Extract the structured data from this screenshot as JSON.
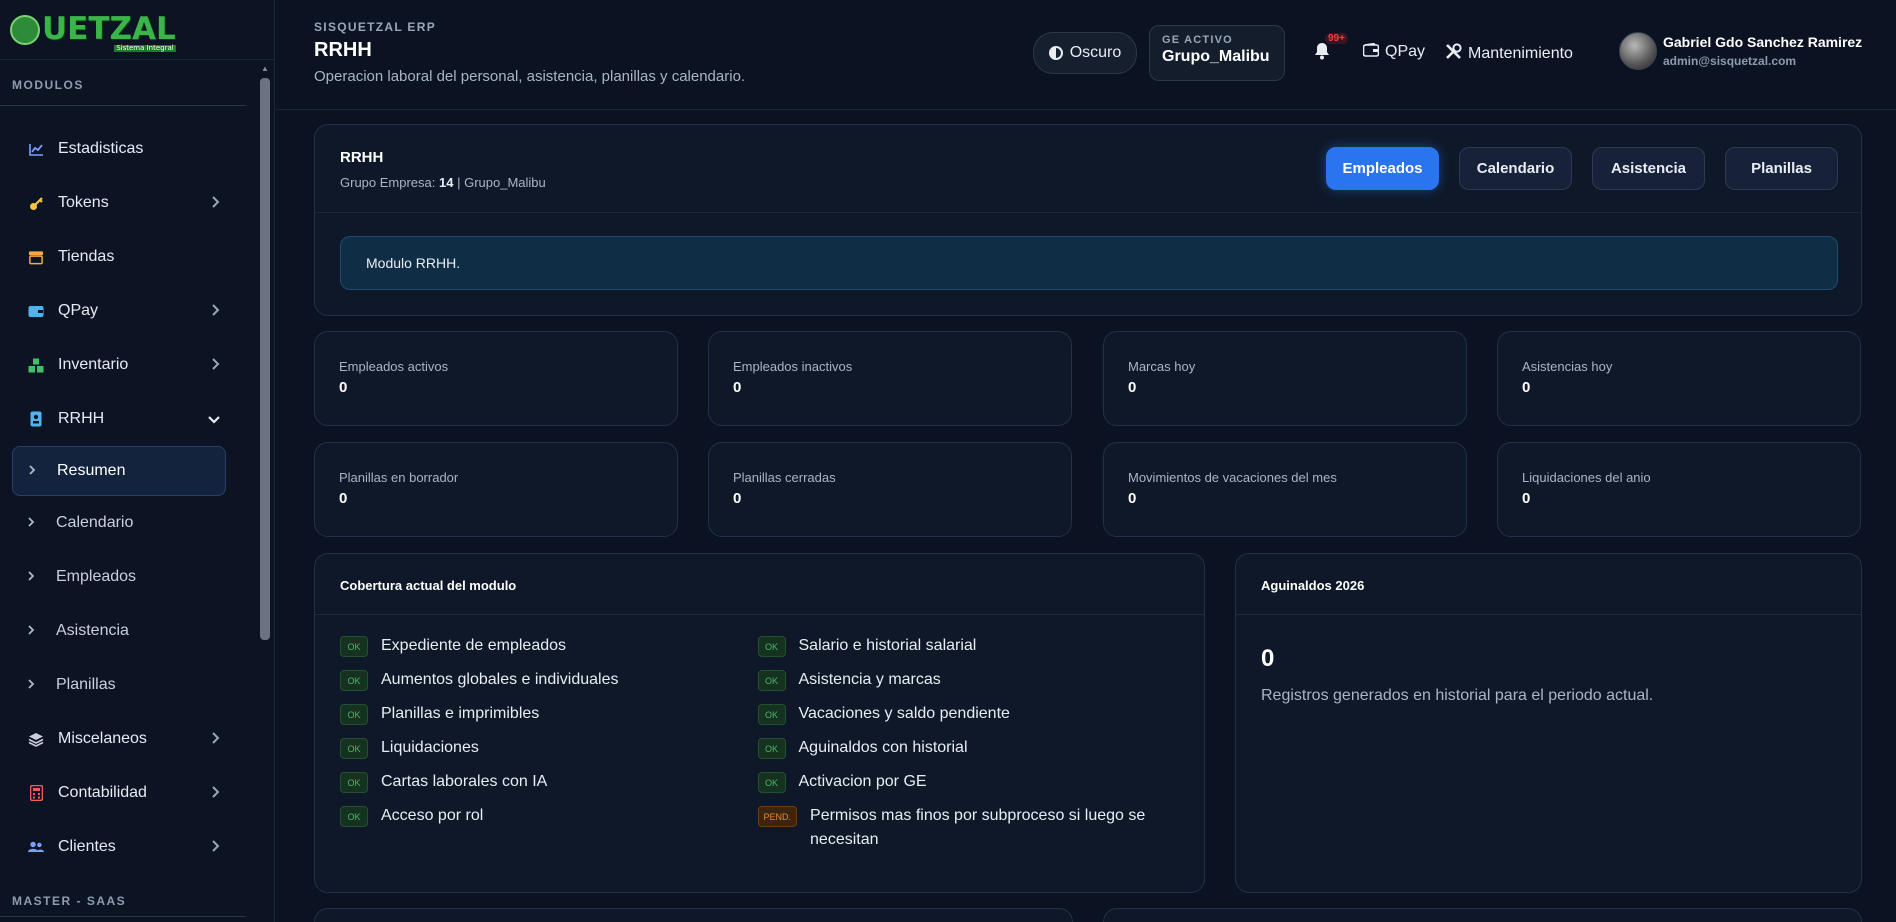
{
  "logo": {
    "text": "UETZAL",
    "sub": "Sistema Integral"
  },
  "sidebar": {
    "section_modules": "MODULOS",
    "section_master": "MASTER - SAAS",
    "items": [
      {
        "label": "Estadisticas",
        "icon": "chart-line-icon",
        "color": "#7aa2ff",
        "chevron": false
      },
      {
        "label": "Tokens",
        "icon": "key-icon",
        "color": "#f5c542",
        "chevron": true
      },
      {
        "label": "Tiendas",
        "icon": "store-icon",
        "color": "#f5a742",
        "chevron": false
      },
      {
        "label": "QPay",
        "icon": "wallet-icon",
        "color": "#4fb3f0",
        "chevron": true
      },
      {
        "label": "Inventario",
        "icon": "boxes-icon",
        "color": "#3fbf6a",
        "chevron": true
      },
      {
        "label": "RRHH",
        "icon": "id-badge-icon",
        "color": "#4fb3f0",
        "chevron": true,
        "expanded": true
      }
    ],
    "subitems": [
      {
        "label": "Resumen",
        "active": true
      },
      {
        "label": "Calendario"
      },
      {
        "label": "Empleados"
      },
      {
        "label": "Asistencia"
      },
      {
        "label": "Planillas"
      }
    ],
    "items_after": [
      {
        "label": "Miscelaneos",
        "icon": "layers-icon",
        "color": "#c8d0dd"
      },
      {
        "label": "Contabilidad",
        "icon": "calculator-icon",
        "color": "#f05a5a"
      },
      {
        "label": "Clientes",
        "icon": "users-icon",
        "color": "#7aa2ff"
      }
    ]
  },
  "header": {
    "brand": "SISQUETZAL ERP",
    "title": "RRHH",
    "subtitle": "Operacion laboral del personal, asistencia, planillas y calendario.",
    "theme_label": "Oscuro",
    "ge_label": "GE ACTIVO",
    "ge_value": "Grupo_Malibu",
    "notif_badge": "99+",
    "qpay_label": "QPay",
    "maint_label": "Mantenimiento",
    "user_name": "Gabriel Gdo Sanchez Ramirez",
    "user_email": "admin@sisquetzal.com"
  },
  "module": {
    "title": "RRHH",
    "group_prefix": "Grupo Empresa:",
    "group_id": "14",
    "group_suffix": "| Grupo_Malibu",
    "tabs": [
      "Empleados",
      "Calendario",
      "Asistencia",
      "Planillas"
    ],
    "info": "Modulo RRHH."
  },
  "stats": [
    {
      "label": "Empleados activos",
      "value": "0"
    },
    {
      "label": "Empleados inactivos",
      "value": "0"
    },
    {
      "label": "Marcas hoy",
      "value": "0"
    },
    {
      "label": "Asistencias hoy",
      "value": "0"
    },
    {
      "label": "Planillas en borrador",
      "value": "0"
    },
    {
      "label": "Planillas cerradas",
      "value": "0"
    },
    {
      "label": "Movimientos de vacaciones del mes",
      "value": "0"
    },
    {
      "label": "Liquidaciones del anio",
      "value": "0"
    }
  ],
  "coverage": {
    "title": "Cobertura actual del modulo",
    "left": [
      {
        "badge": "OK",
        "text": "Expediente de empleados"
      },
      {
        "badge": "OK",
        "text": "Aumentos globales e individuales"
      },
      {
        "badge": "OK",
        "text": "Planillas e imprimibles"
      },
      {
        "badge": "OK",
        "text": "Liquidaciones"
      },
      {
        "badge": "OK",
        "text": "Cartas laborales con IA"
      },
      {
        "badge": "OK",
        "text": "Acceso por rol"
      }
    ],
    "right": [
      {
        "badge": "OK",
        "text": "Salario e historial salarial"
      },
      {
        "badge": "OK",
        "text": "Asistencia y marcas"
      },
      {
        "badge": "OK",
        "text": "Vacaciones y saldo pendiente"
      },
      {
        "badge": "OK",
        "text": "Aguinaldos con historial"
      },
      {
        "badge": "OK",
        "text": "Activacion por GE"
      },
      {
        "badge": "PEND.",
        "text": "Permisos mas finos por subproceso si luego se necesitan"
      }
    ]
  },
  "aguinaldos": {
    "title": "Aguinaldos 2026",
    "value": "0",
    "description": "Registros generados en historial para el periodo actual."
  }
}
